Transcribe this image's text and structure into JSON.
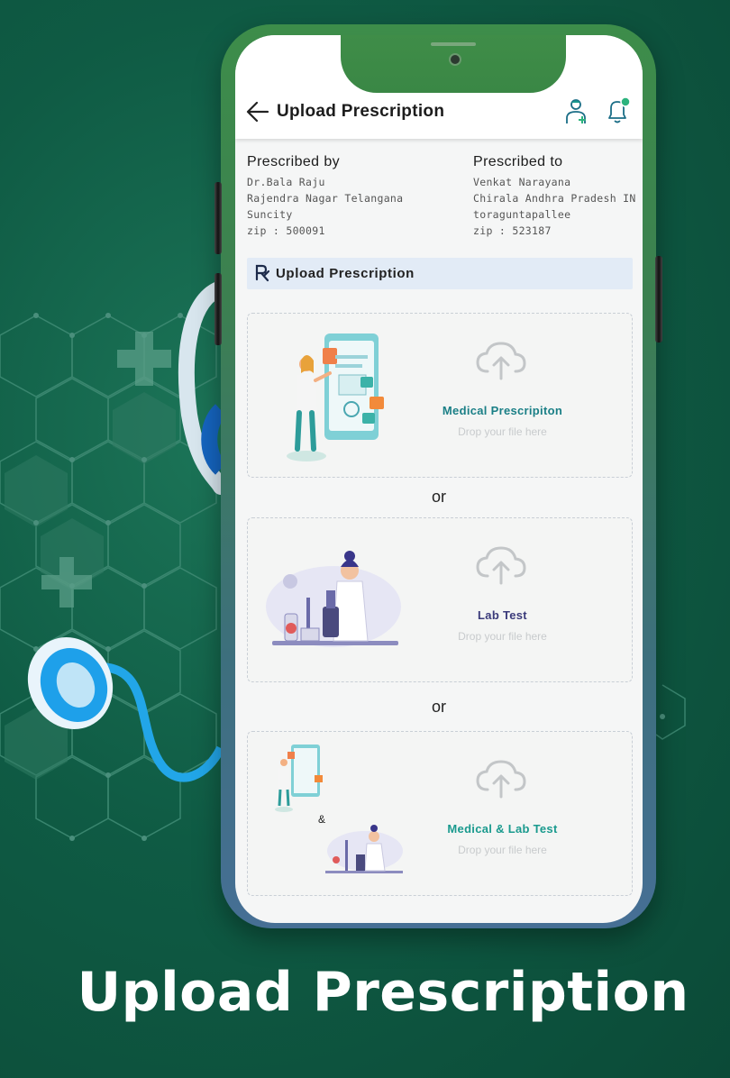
{
  "header": {
    "title": "Upload Prescription"
  },
  "prescribed_by": {
    "heading": "Prescribed by",
    "lines": [
      "Dr.Bala Raju",
      "Rajendra Nagar Telangana",
      "Suncity",
      "zip : 500091"
    ]
  },
  "prescribed_to": {
    "heading": "Prescribed to",
    "lines": [
      "Venkat Narayana",
      "Chirala Andhra Pradesh IN",
      "toraguntapallee",
      "zip : 523187"
    ]
  },
  "section": {
    "title": "Upload Prescription",
    "icon": "rx-icon"
  },
  "cards": [
    {
      "title": "Medical Prescripiton",
      "hint": "Drop your file here",
      "title_color": "#1a7f86"
    },
    {
      "title": "Lab Test",
      "hint": "Drop your file here",
      "title_color": "#3a3a7a"
    },
    {
      "title": "Medical & Lab Test",
      "hint": "Drop your file here",
      "title_color": "#1a9a8e"
    }
  ],
  "separators": [
    "or",
    "or"
  ],
  "ampersand": "&",
  "tagline": "Upload Prescription",
  "colors": {
    "background": "#0f5b44",
    "phone_top": "#3d8d4a",
    "phone_bottom": "#466f95",
    "section_bar": "#e2ebf6"
  }
}
